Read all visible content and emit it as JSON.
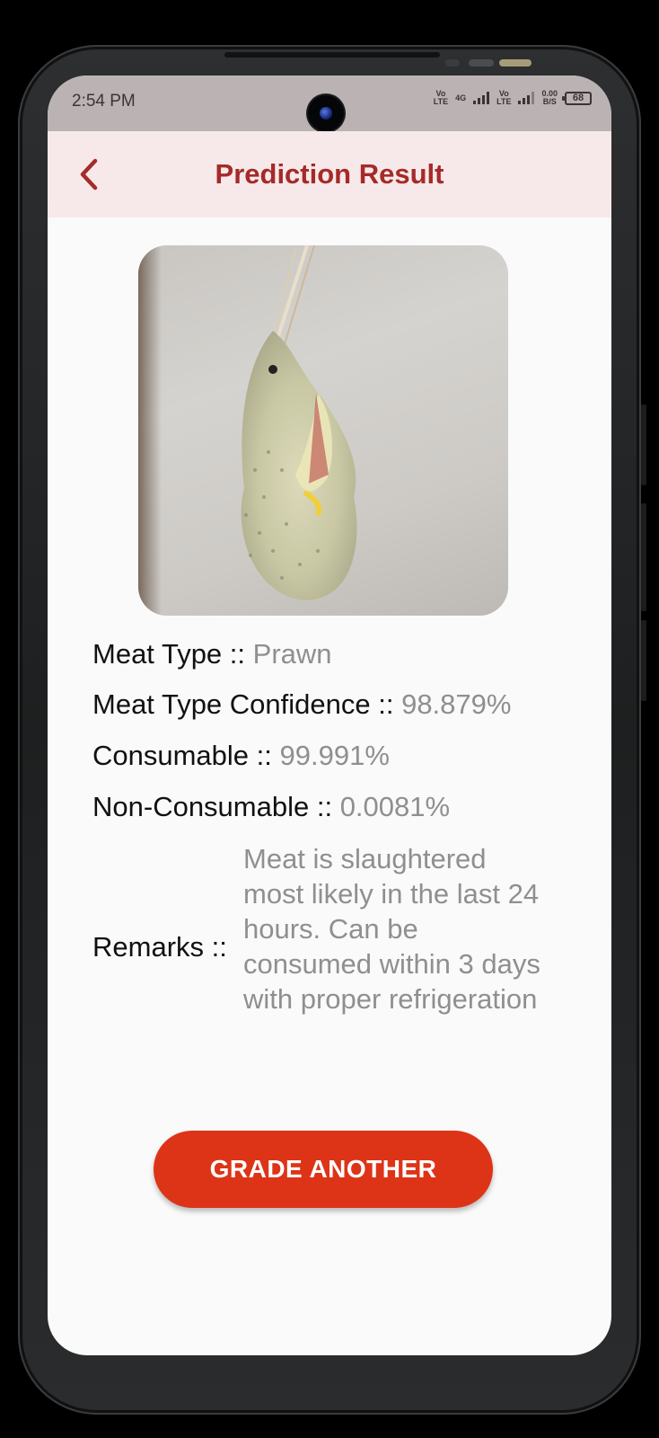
{
  "status_bar": {
    "time": "2:54 PM",
    "sim1_top": "Vo",
    "sim1_bottom": "LTE",
    "net_type": "4G",
    "sim2_top": "Vo",
    "sim2_bottom": "LTE",
    "speed_top": "0.00",
    "speed_bottom": "B/S",
    "battery": "68"
  },
  "app_bar": {
    "title": "Prediction Result",
    "back_icon": "chevron-left-icon"
  },
  "result": {
    "meat_type_label": "Meat Type :: ",
    "meat_type_value": "Prawn",
    "confidence_label": "Meat Type Confidence :: ",
    "confidence_value": "98.879%",
    "consumable_label": "Consumable :: ",
    "consumable_value": "99.991%",
    "non_consumable_label": "Non-Consumable :: ",
    "non_consumable_value": "0.0081%",
    "remarks_label": "Remarks :: ",
    "remarks_value": "Meat is slaughtered most likely in the last 24 hours. Can be consumed within 3 days with proper refrigeration"
  },
  "actions": {
    "grade_another": "GRADE ANOTHER"
  },
  "colors": {
    "accent": "#a52a2a",
    "button": "#dd3418",
    "app_bar_bg": "#f7e9e9",
    "value_text": "#8f8f8f"
  }
}
